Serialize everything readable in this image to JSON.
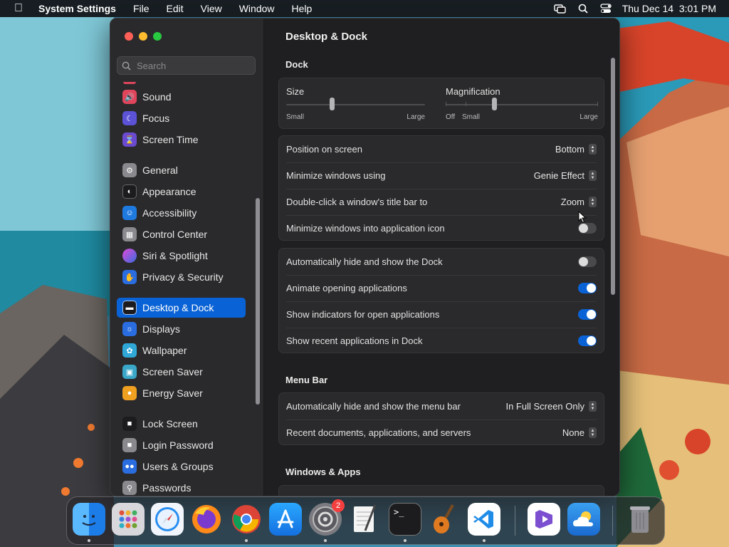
{
  "menubar": {
    "app_name": "System Settings",
    "menus": [
      "File",
      "Edit",
      "View",
      "Window",
      "Help"
    ],
    "clock": "Thu Dec 14  3:01 PM"
  },
  "sidebar": {
    "search_placeholder": "Search",
    "items": [
      {
        "label": "Sound",
        "icon": "speaker-icon",
        "color": "#e0455c"
      },
      {
        "label": "Focus",
        "icon": "moon-icon",
        "color": "#5b52d6"
      },
      {
        "label": "Screen Time",
        "icon": "hourglass-icon",
        "color": "#6a4ad0"
      },
      {
        "label": "General",
        "icon": "gear-icon",
        "color": "#8a8a8e"
      },
      {
        "label": "Appearance",
        "icon": "appearance-icon",
        "color": "#1c1c1e"
      },
      {
        "label": "Accessibility",
        "icon": "accessibility-icon",
        "color": "#1f7ae0"
      },
      {
        "label": "Control Center",
        "icon": "control-center-icon",
        "color": "#8a8a8e"
      },
      {
        "label": "Siri & Spotlight",
        "icon": "siri-icon",
        "color": "#c04bd8"
      },
      {
        "label": "Privacy & Security",
        "icon": "hand-icon",
        "color": "#2a6de0"
      },
      {
        "label": "Desktop & Dock",
        "icon": "desktop-dock-icon",
        "color": "#1c1c1e"
      },
      {
        "label": "Displays",
        "icon": "sun-icon",
        "color": "#2a6de0"
      },
      {
        "label": "Wallpaper",
        "icon": "flower-icon",
        "color": "#2fa8d8"
      },
      {
        "label": "Screen Saver",
        "icon": "screen-saver-icon",
        "color": "#3aa6c8"
      },
      {
        "label": "Energy Saver",
        "icon": "bulb-icon",
        "color": "#f0a020"
      },
      {
        "label": "Lock Screen",
        "icon": "lock-icon",
        "color": "#1c1c1e"
      },
      {
        "label": "Login Password",
        "icon": "lock-closed-icon",
        "color": "#8a8a8e"
      },
      {
        "label": "Users & Groups",
        "icon": "users-icon",
        "color": "#2a6de0"
      },
      {
        "label": "Passwords",
        "icon": "key-icon",
        "color": "#8a8a8e"
      }
    ],
    "selected_index": 9
  },
  "main": {
    "title": "Desktop & Dock",
    "dock_section": "Dock",
    "size": {
      "label": "Size",
      "min_label": "Small",
      "max_label": "Large",
      "value": 0.33
    },
    "magnification": {
      "label": "Magnification",
      "off_label": "Off",
      "min_label": "Small",
      "max_label": "Large",
      "value": 0.32
    },
    "settings": [
      {
        "label": "Position on screen",
        "value": "Bottom"
      },
      {
        "label": "Minimize windows using",
        "value": "Genie Effect"
      },
      {
        "label": "Double-click a window's title bar to",
        "value": "Zoom"
      }
    ],
    "toggle_minimize_into_icon": {
      "label": "Minimize windows into application icon",
      "on": false
    },
    "toggles": [
      {
        "label": "Automatically hide and show the Dock",
        "on": false
      },
      {
        "label": "Animate opening applications",
        "on": true
      },
      {
        "label": "Show indicators for open applications",
        "on": true
      },
      {
        "label": "Show recent applications in Dock",
        "on": true
      }
    ],
    "menu_bar_section": "Menu Bar",
    "menu_bar_settings": [
      {
        "label": "Automatically hide and show the menu bar",
        "value": "In Full Screen Only"
      },
      {
        "label": "Recent documents, applications, and servers",
        "value": "None"
      }
    ],
    "windows_apps_section": "Windows & Apps"
  },
  "dock": {
    "apps": [
      {
        "name": "Finder",
        "icon": "finder-icon",
        "color": "#2a8ef0",
        "running": true
      },
      {
        "name": "Launchpad",
        "icon": "launchpad-icon",
        "color": "#d8d8dc",
        "running": false
      },
      {
        "name": "Safari",
        "icon": "safari-icon",
        "color": "#e8f2ff",
        "running": false
      },
      {
        "name": "Firefox",
        "icon": "firefox-icon",
        "color": "#ff7a1a",
        "running": false
      },
      {
        "name": "Chrome",
        "icon": "chrome-icon",
        "color": "#ffffff",
        "running": true
      },
      {
        "name": "App Store",
        "icon": "app-store-icon",
        "color": "#1d8ff5",
        "running": false
      },
      {
        "name": "System Settings",
        "icon": "system-settings-icon",
        "color": "#8a8a8e",
        "running": true,
        "badge": "2"
      },
      {
        "name": "TextEdit",
        "icon": "textedit-icon",
        "color": "#f4f4f4",
        "running": false
      },
      {
        "name": "Terminal",
        "icon": "terminal-icon",
        "color": "#1c1c1e",
        "running": true
      },
      {
        "name": "GarageBand",
        "icon": "guitar-icon",
        "color": "#3a2a1a",
        "running": false
      },
      {
        "name": "VS Code",
        "icon": "vscode-icon",
        "color": "#ffffff",
        "running": true
      },
      {
        "name": "Visual Studio",
        "icon": "visual-studio-icon",
        "color": "#ffffff",
        "running": false
      },
      {
        "name": "Weather",
        "icon": "weather-icon",
        "color": "#2a8ae0",
        "running": false
      },
      {
        "name": "Trash",
        "icon": "trash-icon",
        "color": "#9a9aa0",
        "running": false
      }
    ]
  }
}
